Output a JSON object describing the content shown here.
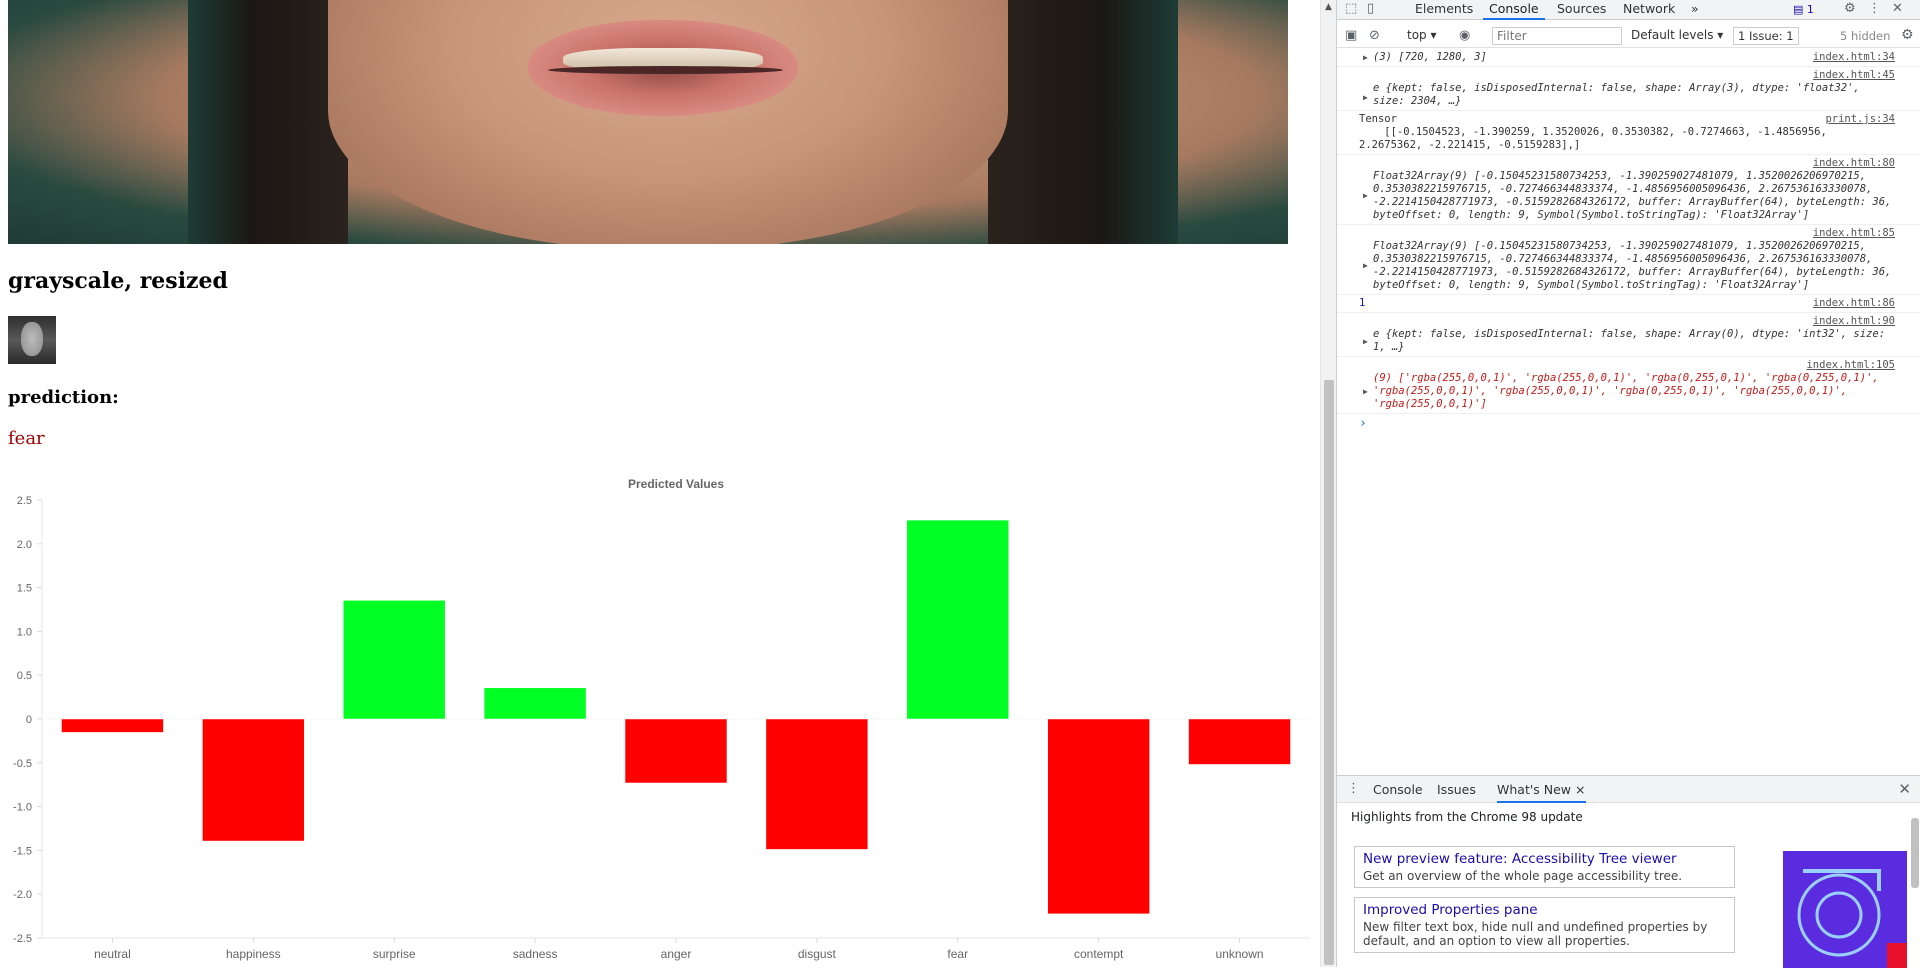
{
  "page": {
    "caption": "grayscale, resized",
    "prediction_label": "prediction:",
    "prediction_value": "fear"
  },
  "colors": {
    "positive_bar": "#00ff22",
    "negative_bar": "#ff0000",
    "prediction_text": "#a00000",
    "devtools_accent": "#1a73e8"
  },
  "chart_data": {
    "type": "bar",
    "title": "Predicted Values",
    "categories": [
      "neutral",
      "happiness",
      "surprise",
      "sadness",
      "anger",
      "disgust",
      "fear",
      "contempt",
      "unknown"
    ],
    "values": [
      -0.1504523,
      -1.390259,
      1.3520026,
      0.3530382,
      -0.7274663,
      -1.4856956,
      2.2675362,
      -2.221415,
      -0.5159283
    ],
    "bar_colors": [
      "rgba(255,0,0,1)",
      "rgba(255,0,0,1)",
      "rgba(0,255,0,1)",
      "rgba(0,255,0,1)",
      "rgba(255,0,0,1)",
      "rgba(255,0,0,1)",
      "rgba(0,255,0,1)",
      "rgba(255,0,0,1)",
      "rgba(255,0,0,1)"
    ],
    "ylim": [
      -2.5,
      2.5
    ],
    "yticks": [
      "2.5",
      "2.0",
      "1.5",
      "1.0",
      "0.5",
      "0",
      "-0.5",
      "-1.0",
      "-1.5",
      "-2.0",
      "-2.5"
    ],
    "xlabel": "",
    "ylabel": "",
    "grid": false,
    "legend": "none"
  },
  "devtools": {
    "tabs": [
      "Elements",
      "Console",
      "Sources",
      "Network"
    ],
    "active_tab": "Console",
    "more_tabs": "»",
    "issue_badge": "1",
    "context": "top ▾",
    "filter_placeholder": "Filter",
    "levels": "Default levels ▾",
    "issues": "1 Issue: 1",
    "hidden": "5 hidden",
    "messages": [
      {
        "src": "index.html:34",
        "text": "(3) [720, 1280, 3]"
      },
      {
        "src": "index.html:45",
        "text": "e {kept: false, isDisposedInternal: false, shape: Array(3), dtype: 'float32', size: 2304, …}"
      },
      {
        "src": "print.js:34",
        "text": "Tensor\n    [[-0.1504523, -1.390259, 1.3520026, 0.3530382, -0.7274663, -1.4856956, 2.2675362, -2.221415, -0.5159283],]"
      },
      {
        "src": "index.html:80",
        "text": "Float32Array(9) [-0.15045231580734253, -1.390259027481079, 1.3520026206970215, 0.3530382215976715, -0.727466344833374, -1.4856956005096436, 2.267536163330078, -2.2214150428771973, -0.5159282684326172, buffer: ArrayBuffer(64), byteLength: 36, byteOffset: 0, length: 9, Symbol(Symbol.toStringTag): 'Float32Array']"
      },
      {
        "src": "index.html:85",
        "text": "Float32Array(9) [-0.15045231580734253, -1.390259027481079, 1.3520026206970215, 0.3530382215976715, -0.727466344833374, -1.4856956005096436, 2.267536163330078, -2.2214150428771973, -0.5159282684326172, buffer: ArrayBuffer(64), byteLength: 36, byteOffset: 0, length: 9, Symbol(Symbol.toStringTag): 'Float32Array']"
      },
      {
        "src": "index.html:86",
        "text": "1"
      },
      {
        "src": "index.html:90",
        "text": "e {kept: false, isDisposedInternal: false, shape: Array(0), dtype: 'int32', size: 1, …}"
      },
      {
        "src": "index.html:105",
        "text": "(9) ['rgba(255,0,0,1)', 'rgba(255,0,0,1)', 'rgba(0,255,0,1)', 'rgba(0,255,0,1)', 'rgba(255,0,0,1)', 'rgba(255,0,0,1)', 'rgba(0,255,0,1)', 'rgba(255,0,0,1)', 'rgba(255,0,0,1)']"
      }
    ],
    "prompt": "›",
    "drawer": {
      "tabs": [
        "Console",
        "Issues",
        "What's New"
      ],
      "active_tab": "What's New",
      "close": "×",
      "highlights": "Highlights from the Chrome 98 update",
      "cards": [
        {
          "title": "New preview feature: Accessibility Tree viewer",
          "desc": "Get an overview of the whole page accessibility tree."
        },
        {
          "title": "Improved Properties pane",
          "desc": "New filter text box, hide null and undefined properties by default, and an option to view all properties."
        }
      ]
    },
    "icons": {
      "inspect": "inspect-icon",
      "device": "device-toolbar-icon",
      "settings": "gear-icon",
      "menu": "kebab-menu-icon",
      "close": "close-icon",
      "sidebar": "sidebar-toggle-icon",
      "clear": "clear-console-icon",
      "eye": "live-expression-icon"
    }
  }
}
